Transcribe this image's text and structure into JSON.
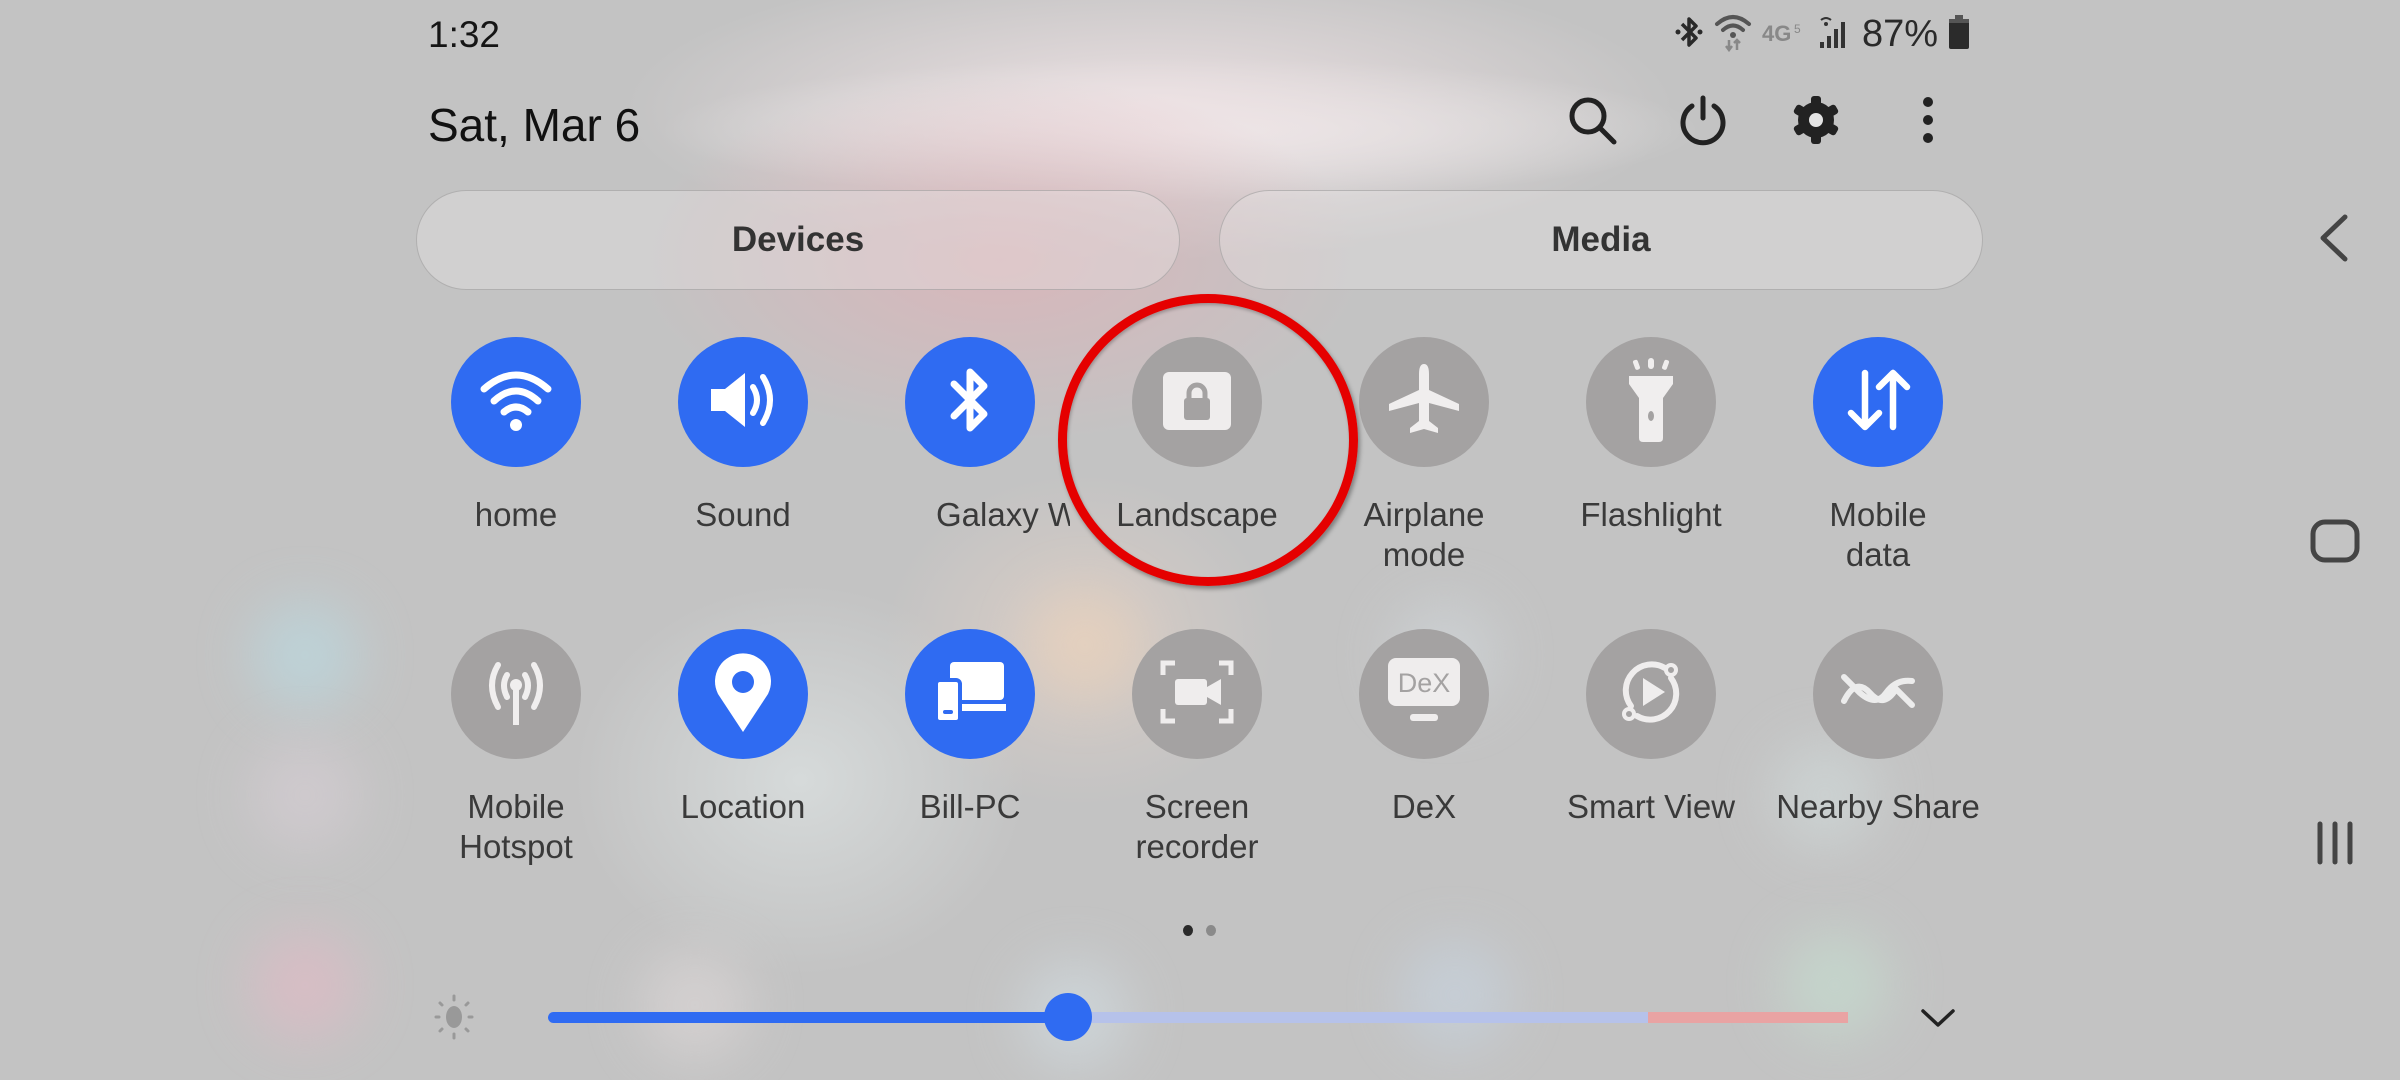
{
  "status_bar": {
    "time": "1:32",
    "battery_percent": "87%",
    "network_label": "4G",
    "icons": [
      "bluetooth-icon",
      "wifi-icon",
      "4g-icon",
      "signal-icon",
      "battery-icon"
    ]
  },
  "header": {
    "date": "Sat, Mar 6",
    "actions": [
      {
        "name": "search",
        "icon": "search-icon"
      },
      {
        "name": "power",
        "icon": "power-icon"
      },
      {
        "name": "settings",
        "icon": "gear-icon"
      },
      {
        "name": "more",
        "icon": "more-vertical-icon"
      }
    ]
  },
  "panels": {
    "devices_label": "Devices",
    "media_label": "Media"
  },
  "tiles_row1": [
    {
      "label": "home",
      "icon": "wifi-icon",
      "active": true
    },
    {
      "label": "Sound",
      "icon": "sound-icon",
      "active": true
    },
    {
      "label": "Galaxy W",
      "icon": "bluetooth-icon",
      "active": true
    },
    {
      "label": "Landscape",
      "icon": "rotation-lock-icon",
      "active": false
    },
    {
      "label": "Airplane\nmode",
      "label_line1": "Airplane",
      "label_line2": "mode",
      "icon": "airplane-icon",
      "active": false
    },
    {
      "label": "Flashlight",
      "icon": "flashlight-icon",
      "active": false
    },
    {
      "label": "Mobile\ndata",
      "label_line1": "Mobile",
      "label_line2": "data",
      "icon": "mobile-data-icon",
      "active": true
    }
  ],
  "tiles_row2": [
    {
      "label_line1": "Mobile",
      "label_line2": "Hotspot",
      "icon": "hotspot-icon",
      "active": false
    },
    {
      "label_line1": "Location",
      "label_line2": "",
      "icon": "location-icon",
      "active": true
    },
    {
      "label_line1": "Bill-PC",
      "label_line2": "",
      "icon": "link-to-pc-icon",
      "active": true
    },
    {
      "label_line1": "Screen",
      "label_line2": "recorder",
      "icon": "screen-recorder-icon",
      "active": false
    },
    {
      "label_line1": "DeX",
      "label_line2": "",
      "icon": "dex-icon",
      "active": false,
      "icon_text": "DeX"
    },
    {
      "label_line1": "Smart View",
      "label_line2": "",
      "icon": "smart-view-icon",
      "active": false
    },
    {
      "label_line1": "Nearby Share",
      "label_line2": "",
      "icon": "nearby-share-icon",
      "active": false
    }
  ],
  "pagination": {
    "current": 1,
    "total": 2
  },
  "brightness": {
    "value_fraction": 0.4,
    "icon": "brightness-icon"
  },
  "colors": {
    "accent": "#2f6bf2",
    "inactive": "#a4a2a2",
    "highlight": "#e50000"
  },
  "nav_bar": [
    "back",
    "home",
    "recents"
  ]
}
